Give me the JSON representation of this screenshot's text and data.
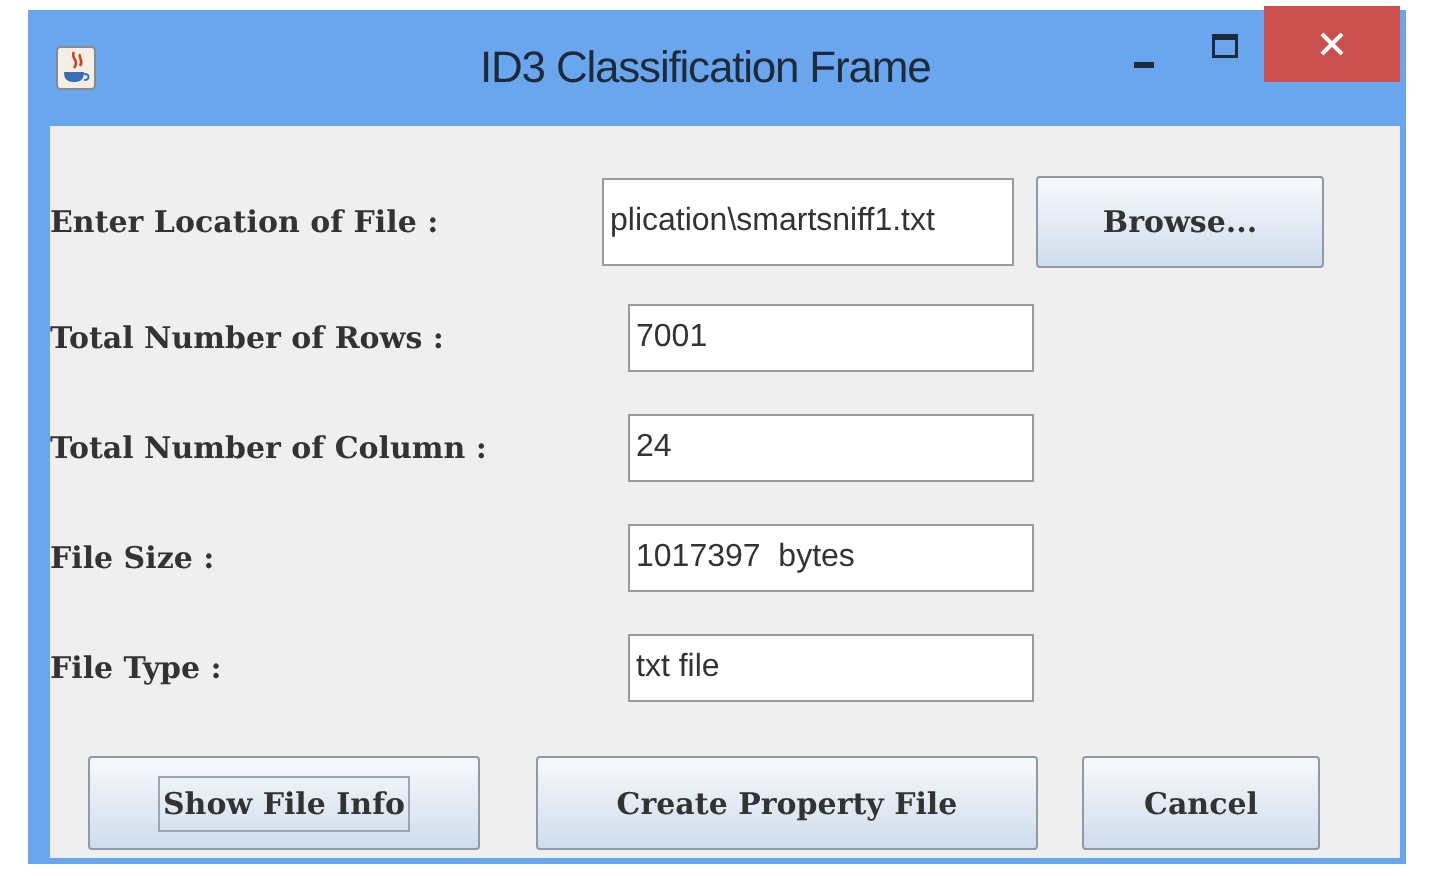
{
  "window": {
    "title": "ID3 Classification Frame"
  },
  "fields": [
    {
      "label": "Enter Location of File :",
      "value": "plication\\smartsniff1.txt",
      "browse": "Browse..."
    },
    {
      "label": "Total Number of Rows :",
      "value": "7001"
    },
    {
      "label": "Total Number of Column :",
      "value": "24"
    },
    {
      "label": "File Size :",
      "value": "1017397  bytes"
    },
    {
      "label": "File Type :",
      "value": "txt file"
    }
  ],
  "buttons": [
    {
      "label": "Show File Info",
      "focused": true
    },
    {
      "label": "Create Property File",
      "focused": false
    },
    {
      "label": "Cancel",
      "focused": false
    }
  ]
}
